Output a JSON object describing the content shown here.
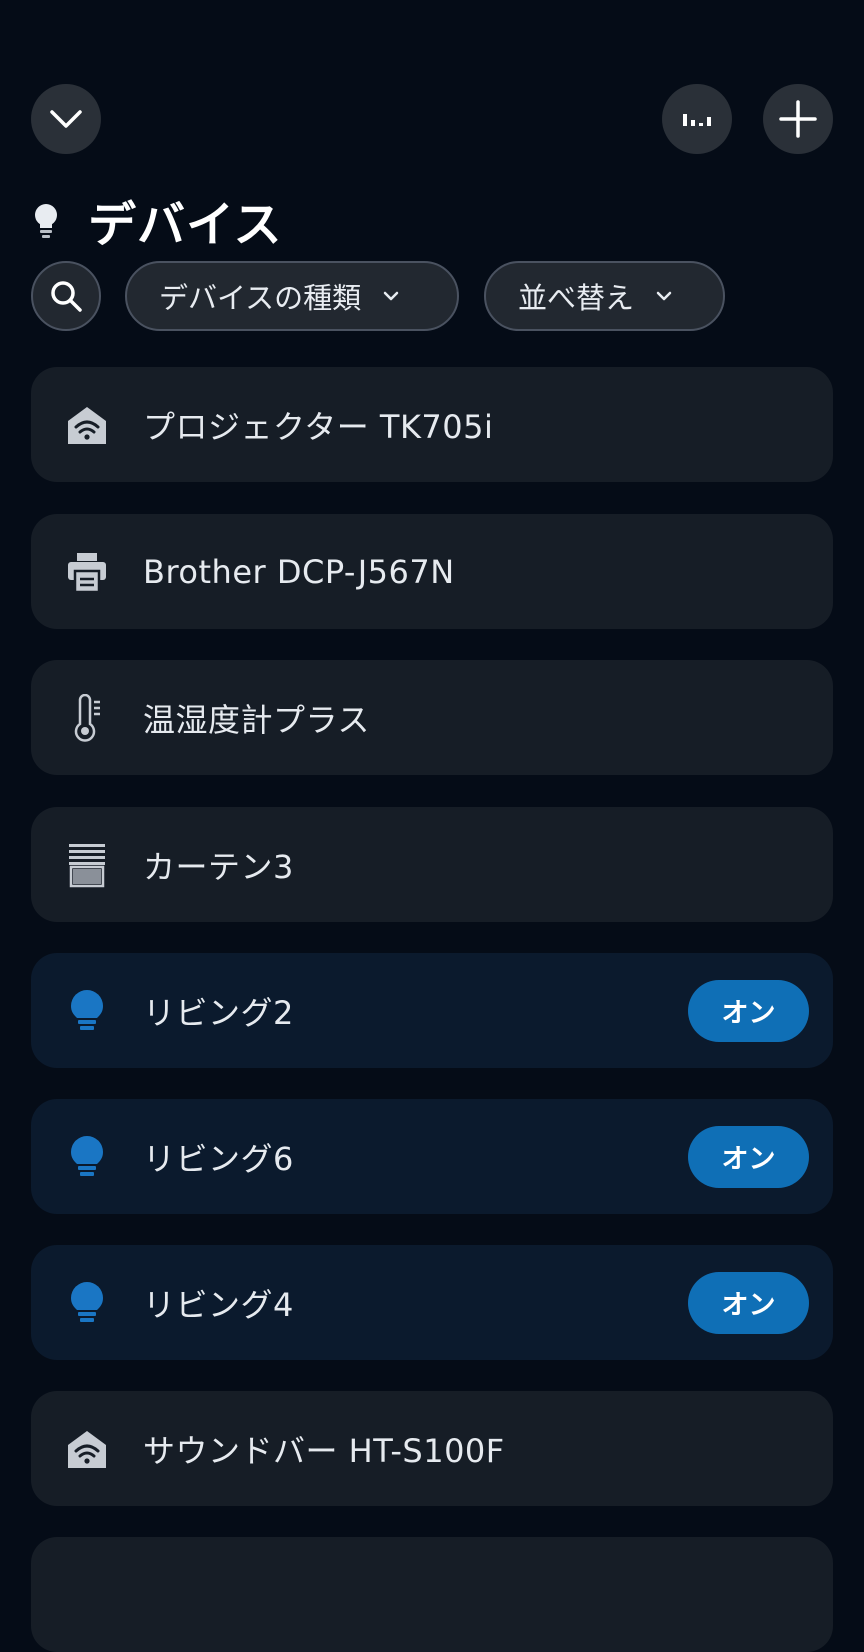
{
  "header": {
    "title": "デバイス",
    "collapse_icon": "chevron-down-icon",
    "activity_icon": "activity-bars-icon",
    "add_icon": "plus-icon"
  },
  "filters": {
    "search_icon": "search-icon",
    "device_type_label": "デバイスの種類",
    "sort_label": "並べ替え"
  },
  "colors": {
    "background": "#050c17",
    "card": "#161d26",
    "card_on": "#0b1a2d",
    "accent": "#0f6fb6",
    "bulb_on": "#1a76c4"
  },
  "devices": [
    {
      "name": "プロジェクター TK705i",
      "icon": "wifi-home-icon",
      "state": ""
    },
    {
      "name": "Brother DCP-J567N",
      "icon": "printer-icon",
      "state": ""
    },
    {
      "name": "温湿度計プラス",
      "icon": "thermometer-icon",
      "state": ""
    },
    {
      "name": "カーテン3",
      "icon": "curtain-icon",
      "state": ""
    },
    {
      "name": "リビング2",
      "icon": "lightbulb-icon",
      "state": "オン"
    },
    {
      "name": "リビング6",
      "icon": "lightbulb-icon",
      "state": "オン"
    },
    {
      "name": "リビング4",
      "icon": "lightbulb-icon",
      "state": "オン"
    },
    {
      "name": "サウンドバー HT-S100F",
      "icon": "wifi-home-icon",
      "state": ""
    }
  ]
}
